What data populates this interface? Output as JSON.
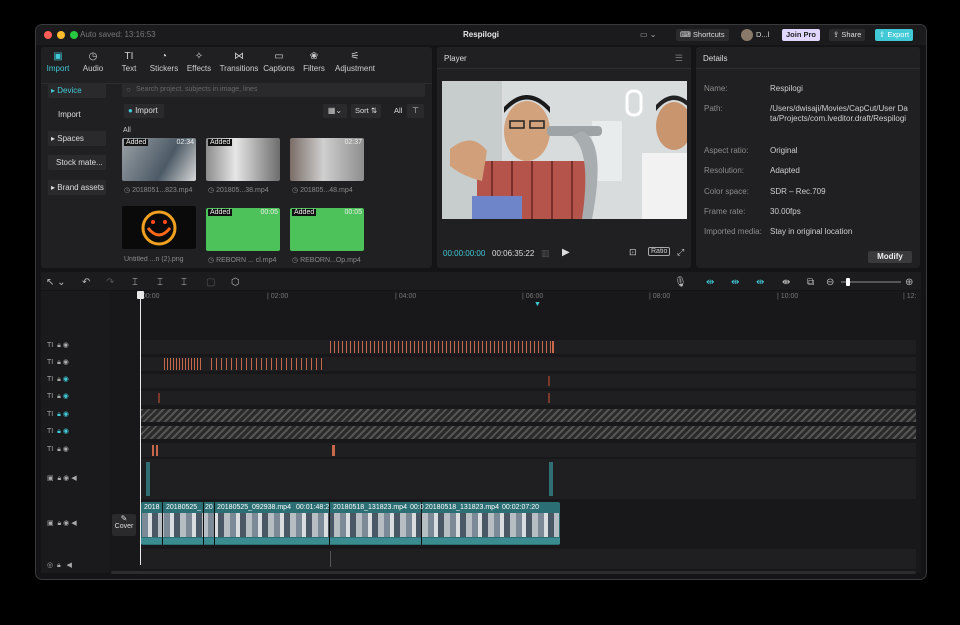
{
  "titlebar": {
    "autosave": "Auto saved: 13:16:53",
    "title": "Respilogi",
    "shortcuts": "Shortcuts",
    "user": "D...l",
    "join_pro": "Join Pro",
    "share": "Share",
    "export": "Export"
  },
  "toolbar": {
    "tabs": [
      {
        "label": "Import",
        "icon": "import-icon",
        "glyph": "▣"
      },
      {
        "label": "Audio",
        "icon": "audio-icon",
        "glyph": "◷"
      },
      {
        "label": "Text",
        "icon": "text-icon",
        "glyph": "TI"
      },
      {
        "label": "Stickers",
        "icon": "sticker-icon",
        "glyph": "◔"
      },
      {
        "label": "Effects",
        "icon": "effects-icon",
        "glyph": "✧"
      },
      {
        "label": "Transitions",
        "icon": "transitions-icon",
        "glyph": "⋈"
      },
      {
        "label": "Captions",
        "icon": "captions-icon",
        "glyph": "▭"
      },
      {
        "label": "Filters",
        "icon": "filters-icon",
        "glyph": "❀"
      },
      {
        "label": "Adjustment",
        "icon": "adjustment-icon",
        "glyph": "⚟"
      }
    ]
  },
  "sidebar": {
    "items": [
      "▸ Device",
      "Import",
      "▸ Spaces",
      "Stock mate...",
      "▸ Brand assets"
    ]
  },
  "media": {
    "search_placeholder": "Search project, subjects in image, lines",
    "import_btn": "Import",
    "sort": "Sort",
    "all_btn": "All",
    "section": "All",
    "items": [
      {
        "name": "2018051...823.mp4",
        "added": "Added",
        "duration": "02:34"
      },
      {
        "name": "201805...38.mp4",
        "added": "Added",
        "duration": ""
      },
      {
        "name": "201805...48.mp4",
        "added": "",
        "duration": "02:37"
      },
      {
        "name": "Untitled ...n (2).png",
        "added": "",
        "duration": ""
      },
      {
        "name": "REBORN ... cl.mp4",
        "added": "Added",
        "duration": "00:05"
      },
      {
        "name": "REBORN...Op.mp4",
        "added": "Added",
        "duration": "00:05"
      }
    ]
  },
  "player": {
    "title": "Player",
    "current_time": "00:00:00:00",
    "total_time": "00:06:35:22",
    "ratio": "Ratio"
  },
  "details": {
    "title": "Details",
    "rows": [
      {
        "label": "Name:",
        "value": "Respilogi"
      },
      {
        "label": "Path:",
        "value": "/Users/dwisaji/Movies/CapCut/User Data/Projects/com.lveditor.draft/Respilogi"
      },
      {
        "label": "Aspect ratio:",
        "value": "Original"
      },
      {
        "label": "Resolution:",
        "value": "Adapted"
      },
      {
        "label": "Color space:",
        "value": "SDR – Rec.709"
      },
      {
        "label": "Frame rate:",
        "value": "30.00fps"
      },
      {
        "label": "Imported media:",
        "value": "Stay in original location"
      }
    ],
    "modify": "Modify"
  },
  "timeline": {
    "ruler": [
      "00:00",
      "| 02:00",
      "| 04:00",
      "| 06:00",
      "| 08:00",
      "| 10:00",
      "| 12:"
    ],
    "cover": "Cover",
    "clips": [
      "2018",
      "20180525_",
      "20",
      "20180525_092938.mp4",
      "00:01:48:2",
      "20180518_131823.mp4",
      "00:0",
      "20180518_131823.mp4",
      "00:02:07:20"
    ]
  },
  "colors": {
    "accent": "#41c9d6",
    "orange": "#d67a4d",
    "pro": "#cdb8ff"
  }
}
